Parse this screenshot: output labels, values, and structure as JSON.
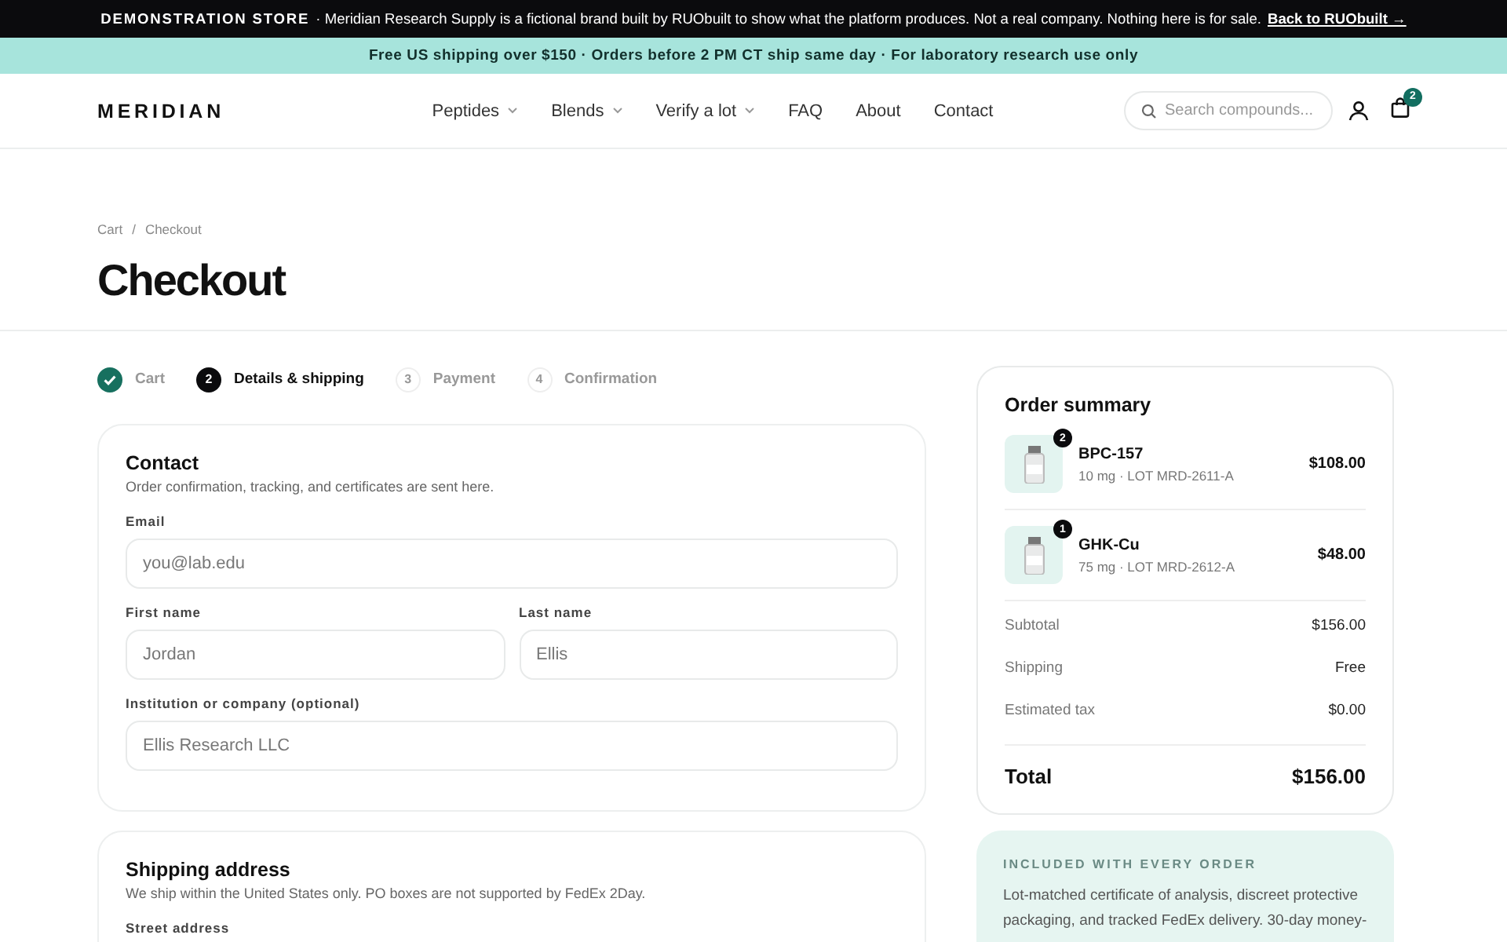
{
  "demo_banner": {
    "label": "DEMONSTRATION STORE",
    "text": "· Meridian Research Supply is a fictional brand built by RUObuilt to show what the platform produces. Not a real company. Nothing here is for sale.",
    "link": "Back to RUObuilt →"
  },
  "promo_bar": {
    "text": "Free US shipping over $150 · Orders before 2 PM CT ship same day · For laboratory research use only"
  },
  "header": {
    "logo": "MERIDIAN",
    "nav": [
      {
        "label": "Peptides",
        "dropdown": true
      },
      {
        "label": "Blends",
        "dropdown": true
      },
      {
        "label": "Verify a lot",
        "dropdown": true
      },
      {
        "label": "FAQ",
        "dropdown": false
      },
      {
        "label": "About",
        "dropdown": false
      },
      {
        "label": "Contact",
        "dropdown": false
      }
    ],
    "search": {
      "placeholder": "Search compounds..."
    },
    "cart_count": "2"
  },
  "breadcrumb": {
    "items": [
      "Cart",
      "Checkout"
    ],
    "separator": "/"
  },
  "title": "Checkout",
  "steps": [
    {
      "label": "Cart",
      "done": true,
      "selected": false
    },
    {
      "number": "2",
      "label": "Details & shipping",
      "done": false,
      "selected": true
    },
    {
      "number": "3",
      "label": "Payment",
      "done": false,
      "selected": false
    },
    {
      "number": "4",
      "label": "Confirmation",
      "done": false,
      "selected": false
    }
  ],
  "sections": [
    {
      "title": "Contact",
      "subtitle": "Order confirmation, tracking, and certificates are sent here.",
      "rows": [
        [
          {
            "label": "Email",
            "placeholder": "you@lab.edu"
          }
        ],
        [
          {
            "label": "First name",
            "placeholder": "Jordan"
          },
          {
            "label": "Last name",
            "placeholder": "Ellis"
          }
        ],
        [
          {
            "label": "Institution or company (optional)",
            "placeholder": "Ellis Research LLC"
          }
        ]
      ]
    },
    {
      "title": "Shipping address",
      "subtitle": "We ship within the United States only. PO boxes are not supported by FedEx 2Day.",
      "rows": [
        [
          {
            "label": "Street address"
          }
        ]
      ]
    }
  ],
  "order_summary": {
    "title": "Order summary",
    "items": [
      {
        "name": "BPC-157",
        "quantity": "2",
        "detail": "10 mg · LOT MRD-2611-A",
        "price": "$108.00"
      },
      {
        "name": "GHK-Cu",
        "quantity": "1",
        "detail": "75 mg · LOT MRD-2612-A",
        "price": "$48.00"
      }
    ],
    "lines": [
      {
        "label": "Subtotal",
        "value": "$156.00"
      },
      {
        "label": "Shipping",
        "value": "Free"
      },
      {
        "label": "Estimated tax",
        "value": "$0.00"
      }
    ],
    "total": {
      "label": "Total",
      "value": "$156.00"
    }
  },
  "included": {
    "heading": "INCLUDED WITH EVERY ORDER",
    "text": "Lot-matched certificate of analysis, discreet protective packaging, and tracked FedEx delivery. 30-day money-"
  }
}
